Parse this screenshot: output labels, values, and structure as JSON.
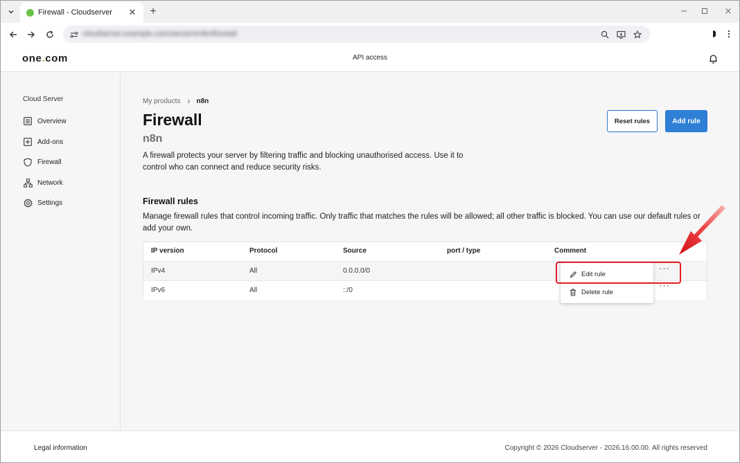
{
  "browser": {
    "tab_title": "Firewall - Cloudserver",
    "url": "cloudserver.example.com/servers/n8n/firewall",
    "new_tab": "+"
  },
  "header": {
    "logo_left": "one",
    "logo_dot": ".",
    "logo_right": "com",
    "api_access": "API access"
  },
  "sidebar": {
    "title": "Cloud Server",
    "items": [
      {
        "label": "Overview",
        "icon": "list-icon"
      },
      {
        "label": "Add-ons",
        "icon": "plus-square-icon"
      },
      {
        "label": "Firewall",
        "icon": "shield-icon"
      },
      {
        "label": "Network",
        "icon": "network-icon"
      },
      {
        "label": "Settings",
        "icon": "gear-icon"
      }
    ]
  },
  "breadcrumb": {
    "parent": "My products",
    "separator": "›",
    "current": "n8n"
  },
  "page": {
    "title": "Firewall",
    "subtitle": "n8n",
    "description": "A firewall protects your server by filtering traffic and blocking unauthorised access. Use it to control who can connect and reduce security risks.",
    "reset_button": "Reset rules",
    "add_button": "Add rule"
  },
  "rules": {
    "heading": "Firewall rules",
    "description": "Manage firewall rules that control incoming traffic. Only traffic that matches the rules will be allowed; all other traffic is blocked. You can use our default rules or add your own.",
    "columns": [
      "IP version",
      "Protocol",
      "Source",
      "port / type",
      "Comment"
    ],
    "rows": [
      {
        "ip_version": "IPv4",
        "protocol": "All",
        "source": "0.0.0.0/0",
        "port": "",
        "comment": "",
        "actions": "···"
      },
      {
        "ip_version": "IPv6",
        "protocol": "All",
        "source": "::/0",
        "port": "",
        "comment": "",
        "actions": "···"
      }
    ]
  },
  "context_menu": {
    "edit": "Edit rule",
    "delete": "Delete rule"
  },
  "footer": {
    "legal": "Legal information",
    "copyright": "Copyright © 2026 Cloudserver - 2026.16.00.00. All rights reserved"
  },
  "colors": {
    "accent": "#2f7fd6",
    "highlight": "#e31d25",
    "logo_dot": "#7ac142"
  }
}
